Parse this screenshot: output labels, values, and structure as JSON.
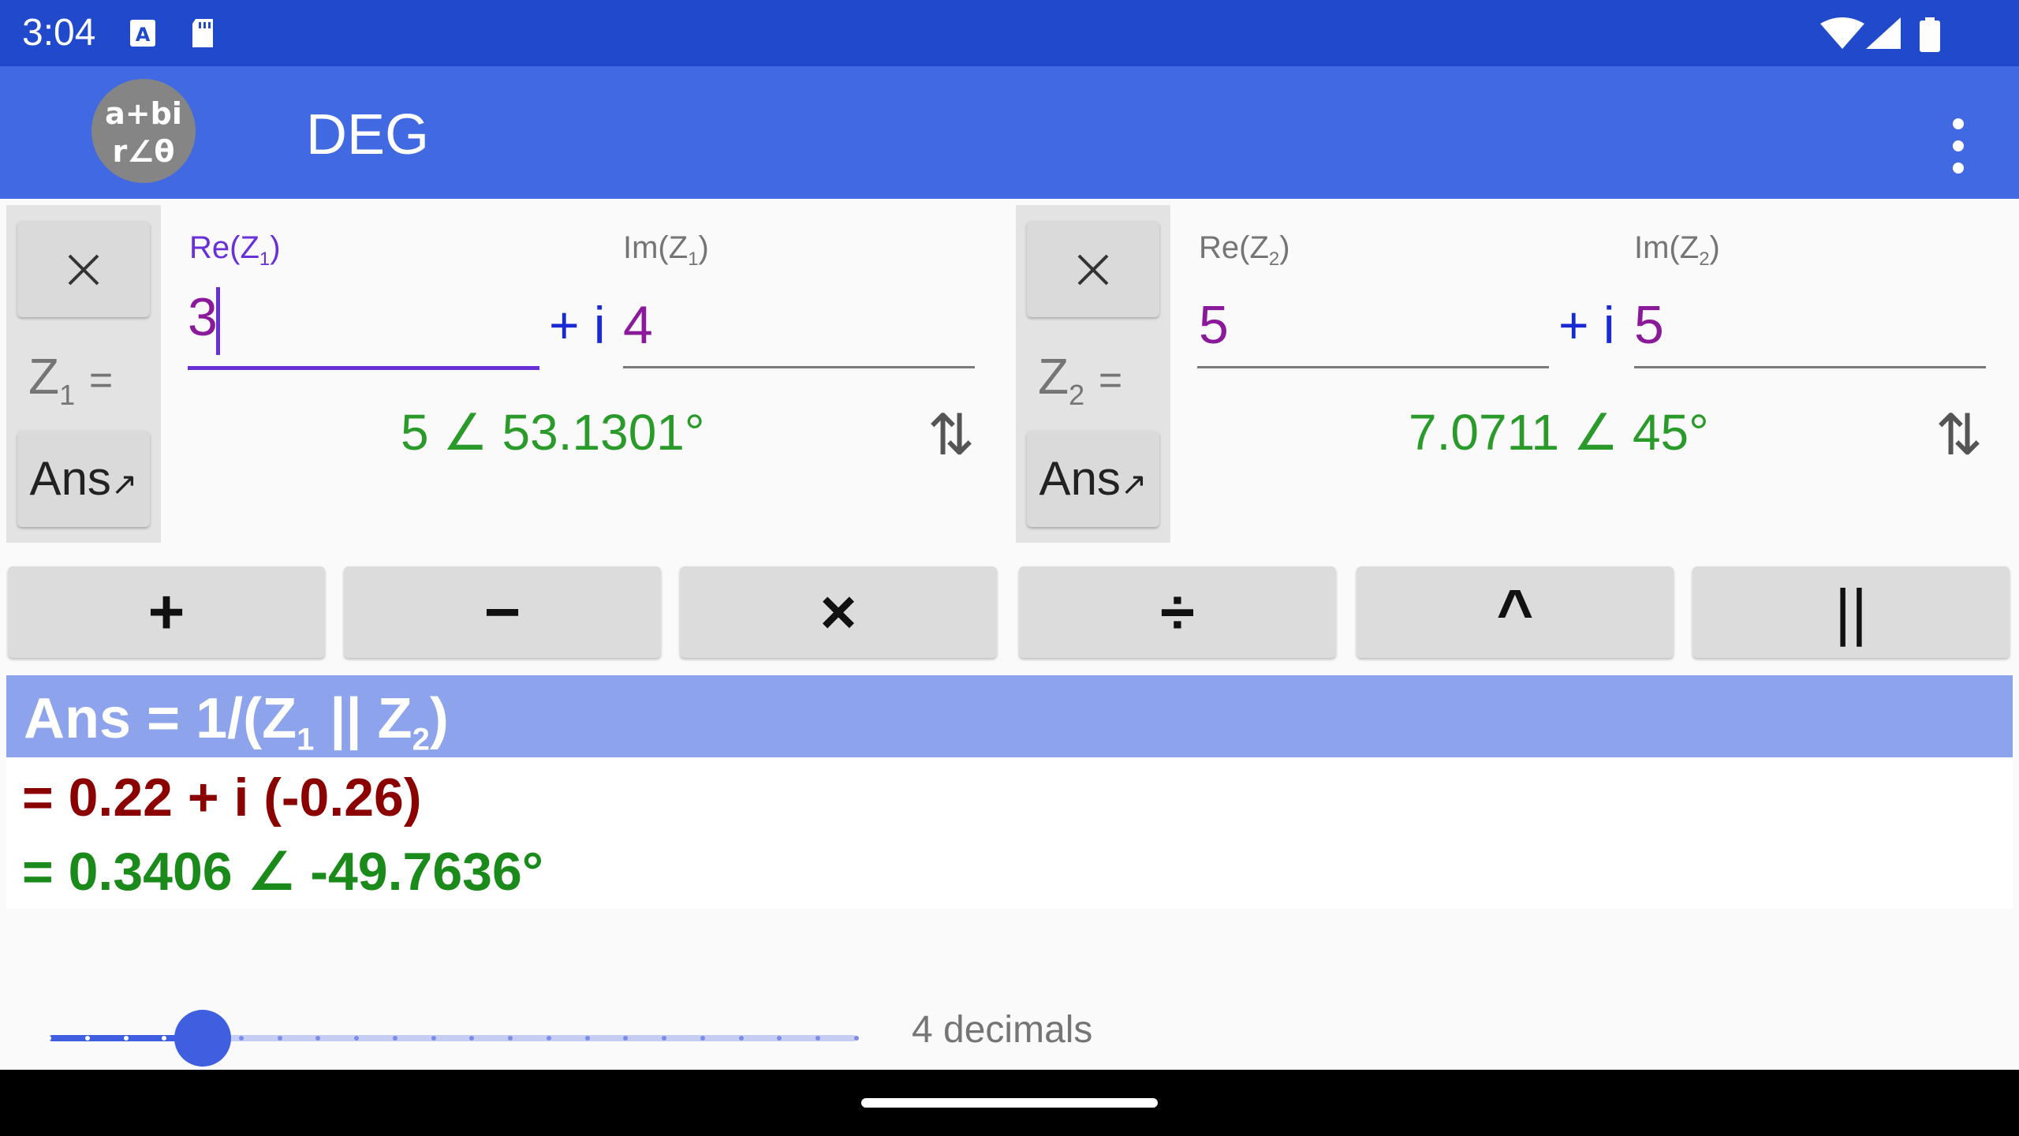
{
  "status_bar": {
    "time": "3:04",
    "icons": [
      "text-a-icon",
      "sd-card-icon",
      "wifi-icon",
      "signal-icon",
      "battery-icon"
    ]
  },
  "app_bar": {
    "mode_badge_line1": "a+bi",
    "mode_badge_line2": "r∠θ",
    "angle_mode": "DEG",
    "menu_icon": "overflow-menu-icon"
  },
  "z1": {
    "label": "Z",
    "label_sub": "1",
    "label_eq": "=",
    "clear_icon": "close-icon",
    "ans_label": "Ans",
    "ans_arrow": "↗",
    "re_label": "Re(Z",
    "re_label_sub": "1",
    "re_label_end": ")",
    "im_label": "Im(Z",
    "im_label_sub": "1",
    "im_label_end": ")",
    "re_value": "3",
    "plus_i": "+ i",
    "im_value": "4",
    "polar": "5 ∠ 53.1301°",
    "swap": "⇅"
  },
  "z2": {
    "label": "Z",
    "label_sub": "2",
    "label_eq": "=",
    "clear_icon": "close-icon",
    "ans_label": "Ans",
    "ans_arrow": "↗",
    "re_label": "Re(Z",
    "re_label_sub": "2",
    "re_label_end": ")",
    "im_label": "Im(Z",
    "im_label_sub": "2",
    "im_label_end": ")",
    "re_value": "5",
    "plus_i": "+ i",
    "im_value": "5",
    "polar": "7.0711 ∠ 45°",
    "swap": "⇅"
  },
  "operators": [
    "+",
    "−",
    "×",
    "÷",
    "^",
    "||"
  ],
  "result": {
    "expr_start": "Ans = 1/(Z",
    "expr_sub1": "1",
    "expr_mid": " || Z",
    "expr_sub2": "2",
    "expr_end": ")",
    "rect": "= 0.22 + i (-0.26)",
    "polar": "= 0.3406 ∠ -49.7636°"
  },
  "decimals": {
    "label": "4 decimals",
    "value": 4,
    "max": 21
  },
  "colors": {
    "status_bar": "#2149cc",
    "app_bar": "#4169e1",
    "result_header": "#8da4ec",
    "active_field": "#6a30d8",
    "polar_text": "#2a9a2a",
    "rect_result": "#8b0000"
  }
}
